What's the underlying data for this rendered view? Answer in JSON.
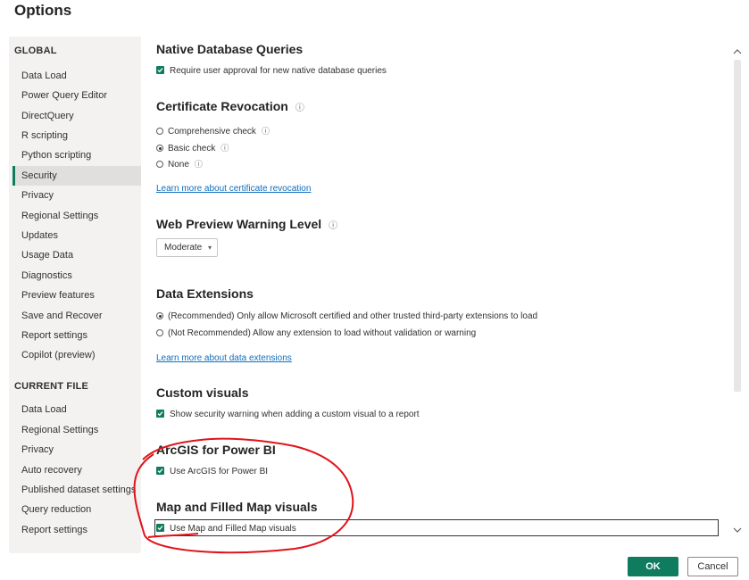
{
  "window": {
    "title": "Options"
  },
  "sidebar": {
    "global_header": "GLOBAL",
    "global_items": [
      {
        "label": "Data Load"
      },
      {
        "label": "Power Query Editor"
      },
      {
        "label": "DirectQuery"
      },
      {
        "label": "R scripting"
      },
      {
        "label": "Python scripting"
      },
      {
        "label": "Security",
        "active": true
      },
      {
        "label": "Privacy"
      },
      {
        "label": "Regional Settings"
      },
      {
        "label": "Updates"
      },
      {
        "label": "Usage Data"
      },
      {
        "label": "Diagnostics"
      },
      {
        "label": "Preview features"
      },
      {
        "label": "Save and Recover"
      },
      {
        "label": "Report settings"
      },
      {
        "label": "Copilot (preview)"
      }
    ],
    "current_header": "CURRENT FILE",
    "current_items": [
      {
        "label": "Data Load"
      },
      {
        "label": "Regional Settings"
      },
      {
        "label": "Privacy"
      },
      {
        "label": "Auto recovery"
      },
      {
        "label": "Published dataset settings"
      },
      {
        "label": "Query reduction"
      },
      {
        "label": "Report settings"
      }
    ]
  },
  "sections": {
    "native_db": {
      "title": "Native Database Queries",
      "option": "Require user approval for new native database queries",
      "checked": true
    },
    "cert": {
      "title": "Certificate Revocation",
      "options": [
        "Comprehensive check",
        "Basic check",
        "None"
      ],
      "selected": "Basic check",
      "link": "Learn more about certificate revocation"
    },
    "web_preview": {
      "title": "Web Preview Warning Level",
      "value": "Moderate"
    },
    "data_ext": {
      "title": "Data Extensions",
      "options": [
        "(Recommended) Only allow Microsoft certified and other trusted third-party extensions to load",
        "(Not Recommended) Allow any extension to load without validation or warning"
      ],
      "selected_index": 0,
      "link": "Learn more about data extensions"
    },
    "custom_visuals": {
      "title": "Custom visuals",
      "option": "Show security warning when adding a custom visual to a report",
      "checked": true
    },
    "arcgis": {
      "title": "ArcGIS for Power BI",
      "option": "Use ArcGIS for Power BI",
      "checked": true
    },
    "map": {
      "title": "Map and Filled Map visuals",
      "option": "Use Map and Filled Map visuals",
      "checked": true
    }
  },
  "footer": {
    "ok": "OK",
    "cancel": "Cancel"
  },
  "colors": {
    "accent": "#0f7b5f",
    "link": "#106ebe",
    "annotation": "#e0131a"
  },
  "icons": {
    "info": "info-icon",
    "check": "check-icon",
    "chevron": "chevron-down-icon"
  }
}
